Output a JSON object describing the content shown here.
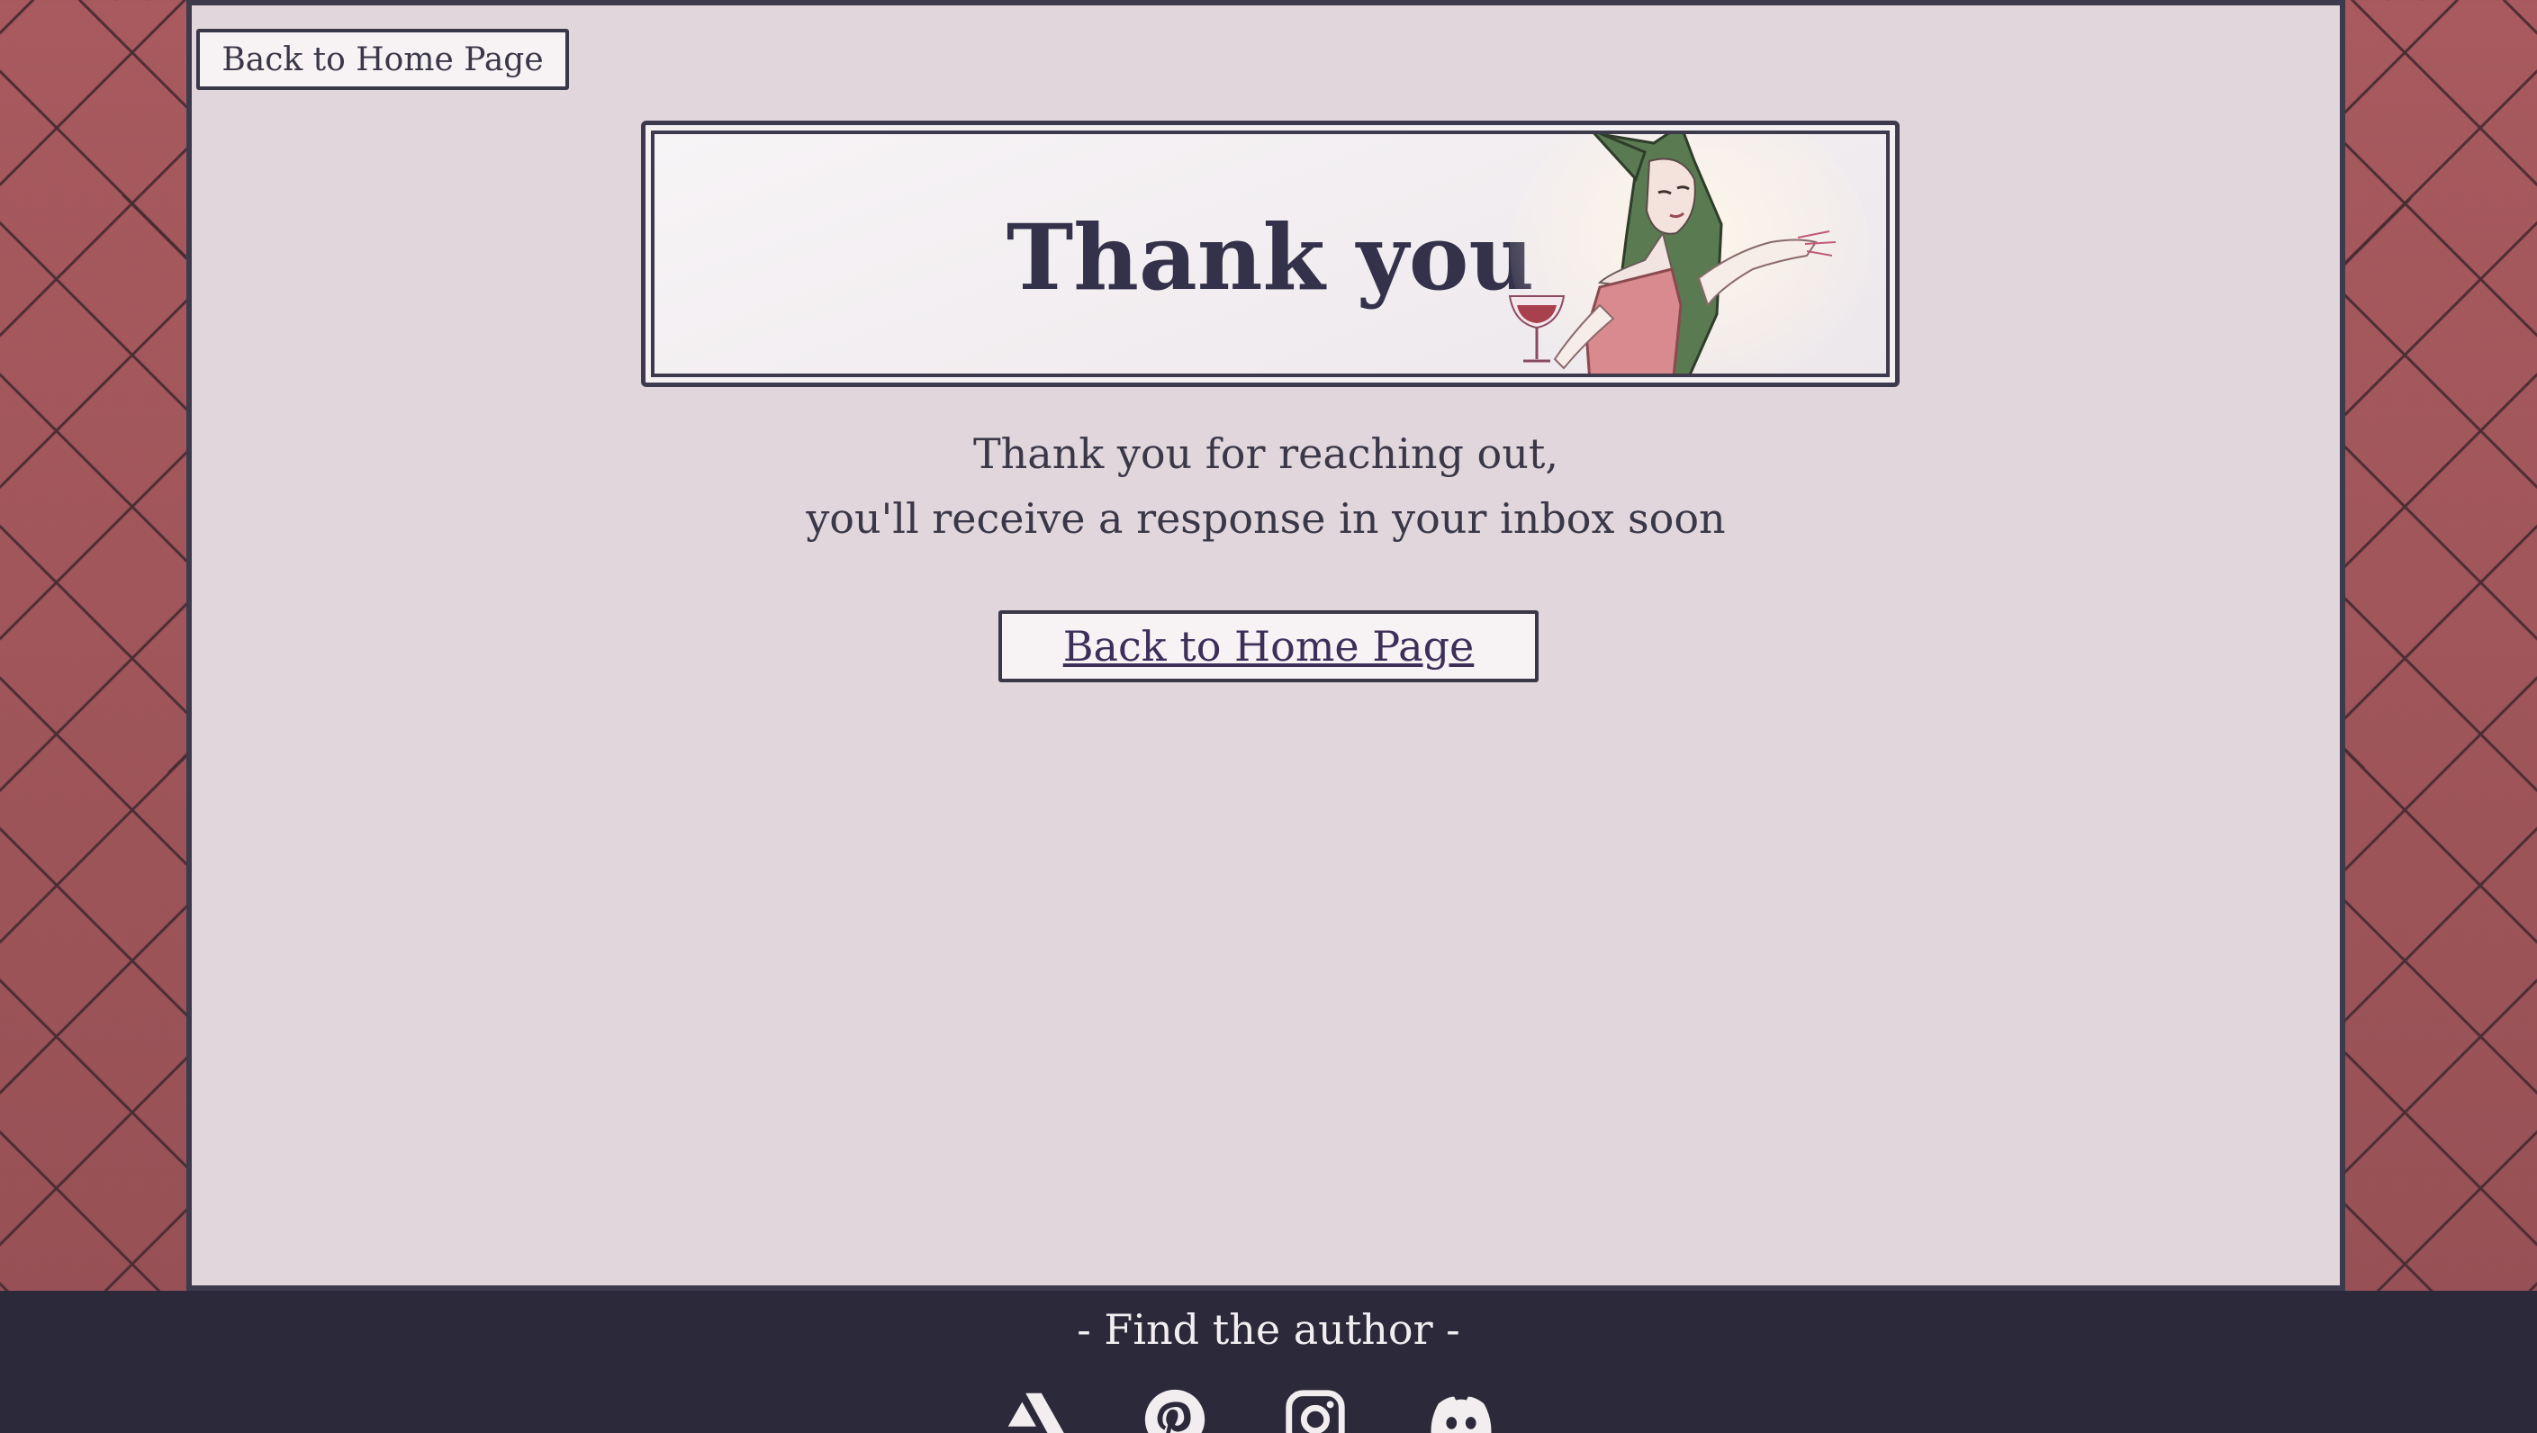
{
  "top_back_button": {
    "label": "Back to Home Page"
  },
  "banner": {
    "title": "Thank you"
  },
  "message": {
    "line1": "Thank you for reaching out,",
    "line2": "you'll receive a response in your inbox soon"
  },
  "main_back_button": {
    "label": "Back to Home Page"
  },
  "footer": {
    "title": "- Find the author -",
    "social_icons": [
      "artstation-icon",
      "pinterest-icon",
      "instagram-icon",
      "discord-icon"
    ]
  },
  "colors": {
    "background": "#9a5458",
    "panel": "#e1d6dc",
    "text": "#3a3848",
    "footer": "#2c2a3a"
  }
}
